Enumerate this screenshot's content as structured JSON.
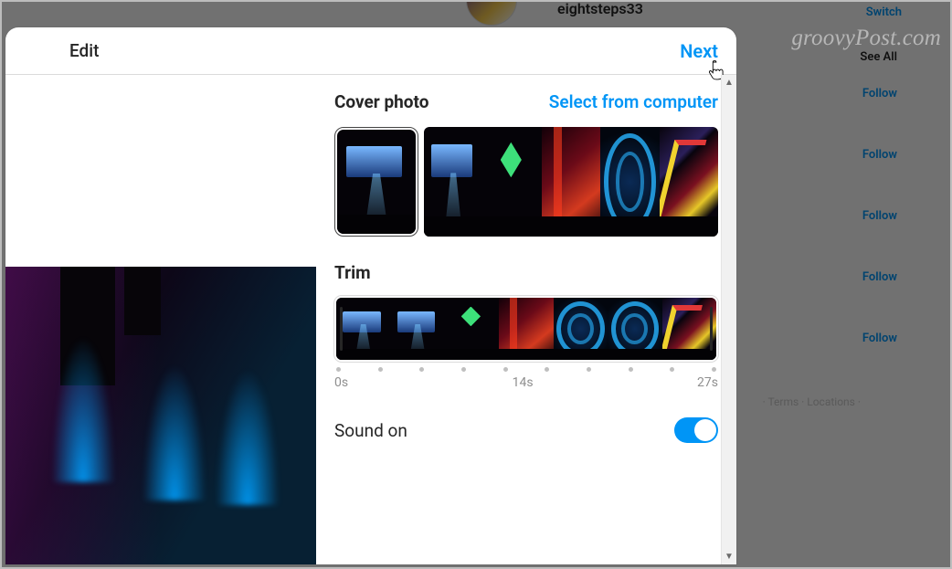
{
  "background": {
    "username": "eightsteps33",
    "switch_label": "Switch",
    "see_all_label": "See All",
    "follow_label": "Follow",
    "footer_links": "· Terms · Locations ·"
  },
  "watermark": "groovyPost.com",
  "modal": {
    "title": "Edit",
    "next_label": "Next",
    "cover": {
      "heading": "Cover photo",
      "select_label": "Select from computer"
    },
    "trim": {
      "heading": "Trim",
      "start": "0s",
      "mid": "14s",
      "end": "27s"
    },
    "sound": {
      "label": "Sound on",
      "on": true
    }
  }
}
